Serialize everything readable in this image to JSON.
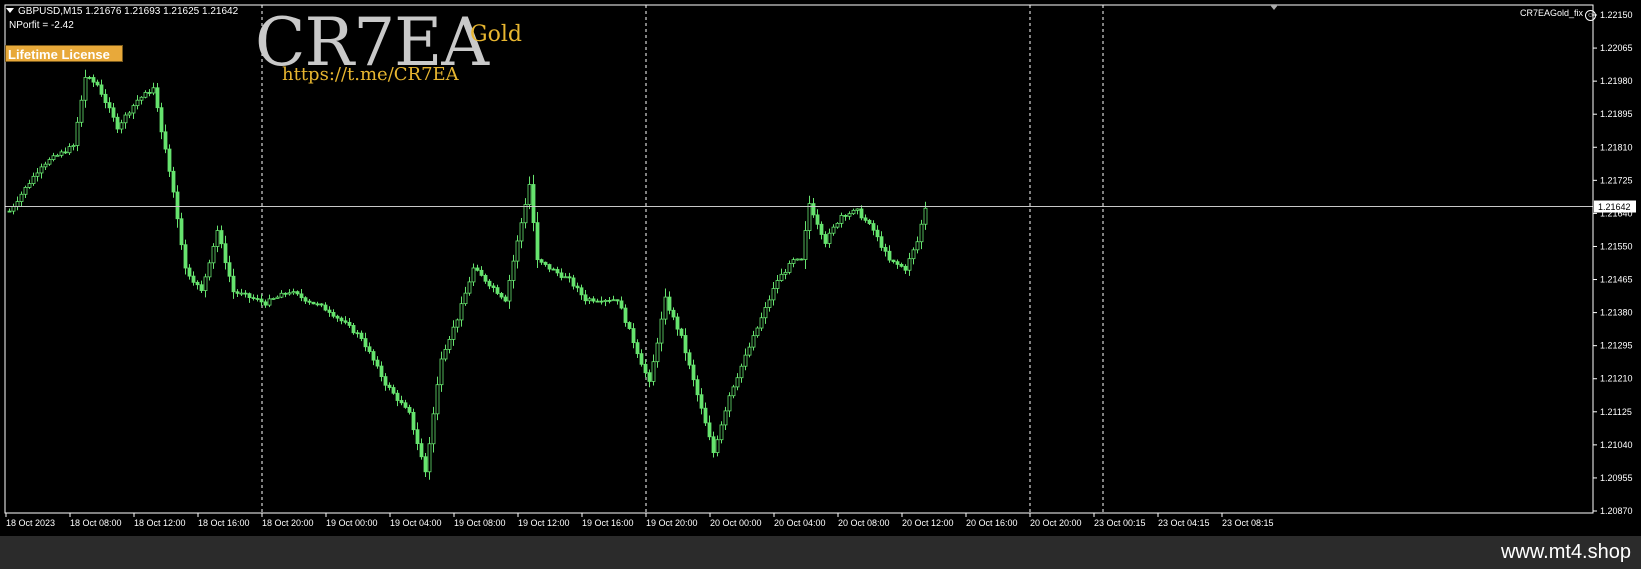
{
  "header": {
    "symbol_line": "GBPUSD,M15  1.21676 1.21693 1.21625 1.21642",
    "profit_line": "NPorfit = -2.42",
    "license_label": "Lifetime License",
    "ea_label": "CR7EAGold_fix"
  },
  "branding": {
    "logo": "CR7EA",
    "sub": "Gold",
    "url": "https://t.me/CR7EA",
    "watermark": "www.mt4.shop"
  },
  "colors": {
    "background": "#000000",
    "candle": "#66e36e",
    "price_line": "#c8c8c8",
    "license_bg": "#e8a93a",
    "brand_gold": "#e8b630"
  },
  "chart_data": {
    "type": "candlestick",
    "symbol": "GBPUSD",
    "timeframe": "M15",
    "current_price": 1.21642,
    "current_price_label": "1.21642",
    "ylim": [
      1.20842,
      1.22168
    ],
    "y_ticks": [
      "1.22150",
      "1.22065",
      "1.21980",
      "1.21895",
      "1.21810",
      "1.21725",
      "1.21640",
      "1.21550",
      "1.21465",
      "1.21380",
      "1.21295",
      "1.21210",
      "1.21125",
      "1.21040",
      "1.20955",
      "1.20870"
    ],
    "x_ticks": [
      "18 Oct 2023",
      "18 Oct 08:00",
      "18 Oct 12:00",
      "18 Oct 16:00",
      "18 Oct 20:00",
      "19 Oct 00:00",
      "19 Oct 04:00",
      "19 Oct 08:00",
      "19 Oct 12:00",
      "19 Oct 16:00",
      "19 Oct 20:00",
      "20 Oct 00:00",
      "20 Oct 04:00",
      "20 Oct 08:00",
      "20 Oct 12:00",
      "20 Oct 16:00",
      "20 Oct 20:00",
      "23 Oct 00:15",
      "23 Oct 04:15",
      "23 Oct 08:15"
    ],
    "separator_after_tick": [
      4,
      10,
      16
    ],
    "bars_total": 230,
    "bars_per_tick": 16,
    "price_path": [
      [
        0,
        1.2163
      ],
      [
        8,
        1.2175
      ],
      [
        16,
        1.218
      ],
      [
        19,
        1.2198
      ],
      [
        22,
        1.2196
      ],
      [
        27,
        1.2185
      ],
      [
        32,
        1.2192
      ],
      [
        36,
        1.2195
      ],
      [
        41,
        1.2168
      ],
      [
        44,
        1.2148
      ],
      [
        48,
        1.2142
      ],
      [
        52,
        1.2158
      ],
      [
        56,
        1.2142
      ],
      [
        64,
        1.2139
      ],
      [
        70,
        1.2142
      ],
      [
        80,
        1.2137
      ],
      [
        88,
        1.213
      ],
      [
        94,
        1.2118
      ],
      [
        100,
        1.211
      ],
      [
        104,
        1.2095
      ],
      [
        108,
        1.2125
      ],
      [
        112,
        1.2135
      ],
      [
        116,
        1.2148
      ],
      [
        124,
        1.214
      ],
      [
        130,
        1.217
      ],
      [
        132,
        1.215
      ],
      [
        140,
        1.2145
      ],
      [
        144,
        1.214
      ],
      [
        152,
        1.214
      ],
      [
        160,
        1.2118
      ],
      [
        164,
        1.214
      ],
      [
        168,
        1.213
      ],
      [
        172,
        1.2115
      ],
      [
        176,
        1.21
      ],
      [
        180,
        1.2115
      ],
      [
        186,
        1.213
      ],
      [
        192,
        1.2145
      ],
      [
        196,
        1.215
      ],
      [
        198,
        1.215
      ],
      [
        200,
        1.2165
      ],
      [
        204,
        1.2155
      ],
      [
        208,
        1.2162
      ],
      [
        212,
        1.2163
      ],
      [
        216,
        1.2158
      ],
      [
        220,
        1.215
      ],
      [
        224,
        1.2148
      ],
      [
        227,
        1.2155
      ],
      [
        229,
        1.2164
      ]
    ]
  }
}
